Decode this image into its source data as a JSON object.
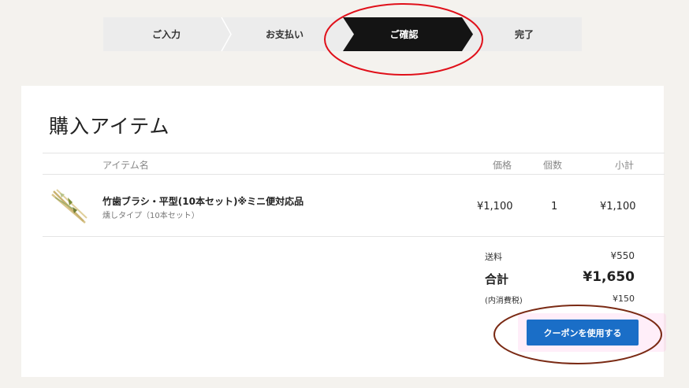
{
  "steps": [
    {
      "label": "ご入力",
      "active": false
    },
    {
      "label": "お支払い",
      "active": false
    },
    {
      "label": "ご確認",
      "active": true
    },
    {
      "label": "完了",
      "active": false
    }
  ],
  "cart": {
    "title": "購入アイテム",
    "columns": {
      "item_name": "アイテム名",
      "price": "価格",
      "quantity": "個数",
      "subtotal": "小計"
    },
    "items": [
      {
        "name": "竹歯ブラシ・平型(10本セット)※ミニ便対応品",
        "variant": "燻しタイプ（10本セット）",
        "price": "¥1,100",
        "quantity": "1",
        "subtotal": "¥1,100"
      }
    ],
    "shipping_label": "送料",
    "shipping_value": "¥550",
    "total_label": "合計",
    "total_value": "¥1,650",
    "tax_label": "(内消費税)",
    "tax_value": "¥150",
    "coupon_button": "クーポンを使用する"
  },
  "colors": {
    "accent_button": "#1a6ec7",
    "active_step": "#141414",
    "annotation_red": "#e0101a",
    "annotation_brown": "#7a2a14"
  }
}
